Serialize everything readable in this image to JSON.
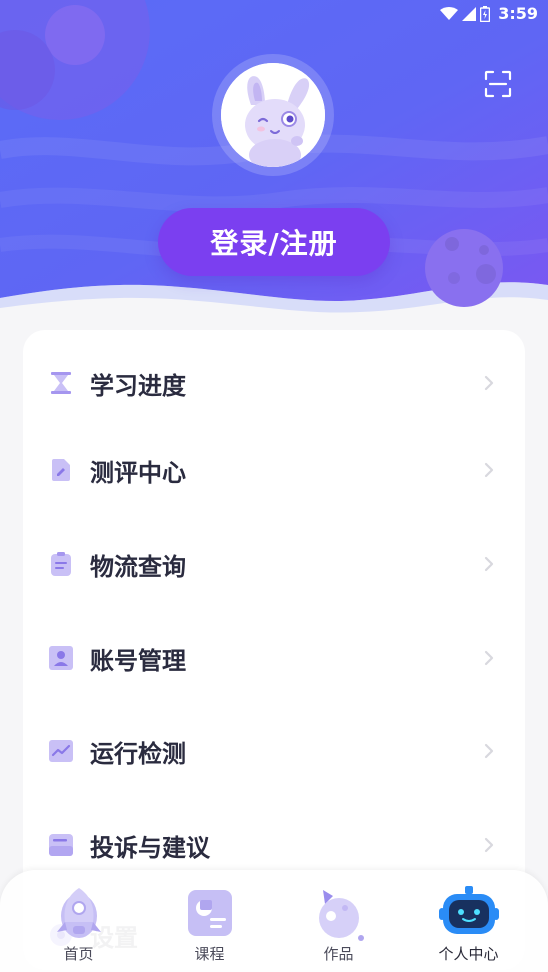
{
  "status_bar": {
    "time": "3:59"
  },
  "profile": {
    "login_label": "登录/注册"
  },
  "menu": [
    {
      "label": "学习进度",
      "icon": "hourglass-icon"
    },
    {
      "label": "测评中心",
      "icon": "document-edit-icon"
    },
    {
      "label": "物流查询",
      "icon": "clipboard-icon"
    },
    {
      "label": "账号管理",
      "icon": "user-card-icon"
    },
    {
      "label": "运行检测",
      "icon": "chart-line-icon"
    },
    {
      "label": "投诉与建议",
      "icon": "feedback-box-icon"
    },
    {
      "label": "设置",
      "icon": "gear-icon"
    }
  ],
  "tabs": [
    {
      "label": "首页",
      "icon": "rocket-icon"
    },
    {
      "label": "课程",
      "icon": "course-book-icon"
    },
    {
      "label": "作品",
      "icon": "planet-icon"
    },
    {
      "label": "个人中心",
      "icon": "robot-icon",
      "active": true
    }
  ],
  "colors": {
    "header_top": "#6d57f5",
    "header_bottom": "#5b7cf5",
    "login_button": "#7b3ff0",
    "icon_purple": "#b9aef5"
  }
}
